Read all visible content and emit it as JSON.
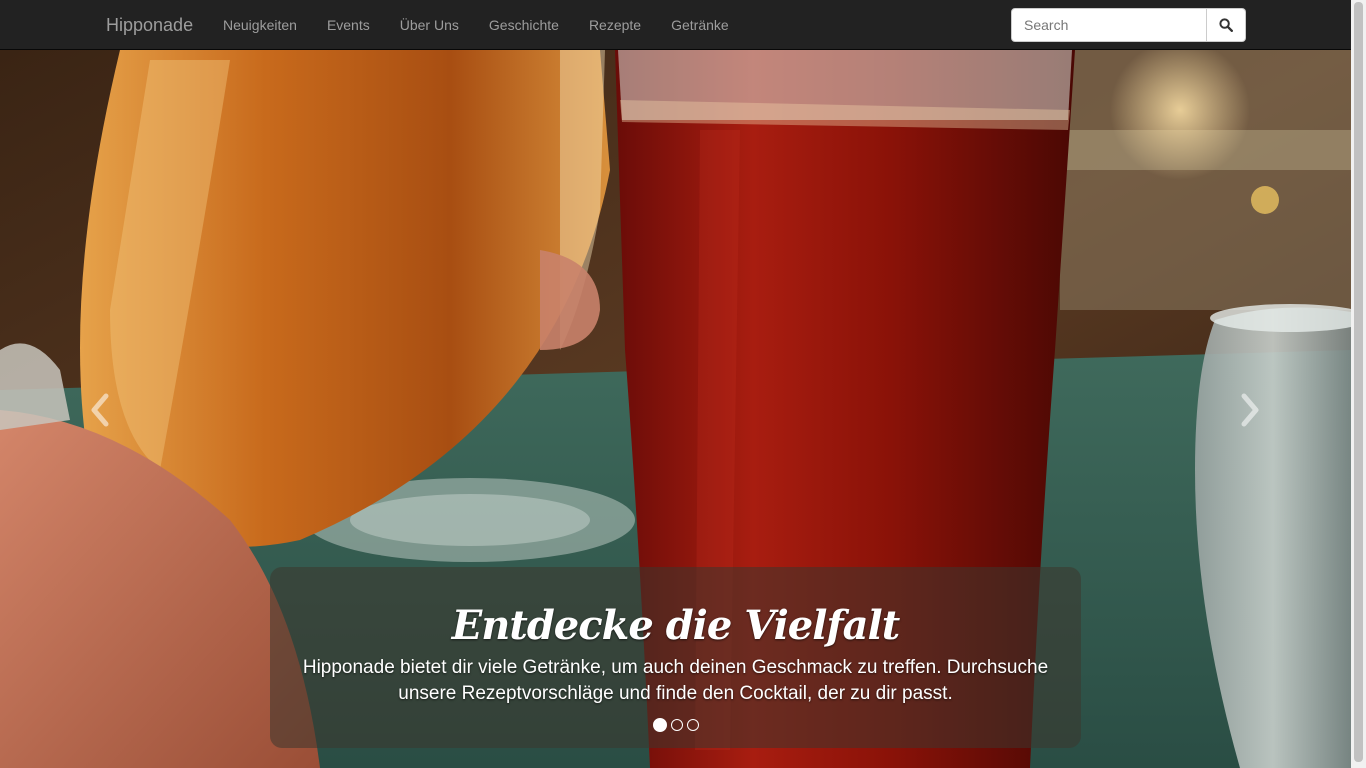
{
  "navbar": {
    "brand": "Hipponade",
    "items": [
      {
        "label": "Neuigkeiten"
      },
      {
        "label": "Events"
      },
      {
        "label": "Über Uns"
      },
      {
        "label": "Geschichte"
      },
      {
        "label": "Rezepte"
      },
      {
        "label": "Getränke"
      }
    ],
    "search": {
      "placeholder": "Search",
      "value": "",
      "icon": "search-icon"
    }
  },
  "carousel": {
    "caption_title": "Entdecke die Vielfalt",
    "caption_text": "Hipponade bietet dir viele Getränke, um auch deinen Geschmack zu treffen. Durchsuche unsere Rezeptvorschläge und finde den Cocktail, der zu dir passt.",
    "slide_count": 3,
    "active_slide": 1,
    "controls": {
      "prev_icon": "chevron-left-icon",
      "next_icon": "chevron-right-icon"
    }
  },
  "colors": {
    "navbar_bg": "#222222",
    "nav_text": "#9d9d9d",
    "caption_bg": "rgba(60,54,45,0.55)"
  }
}
